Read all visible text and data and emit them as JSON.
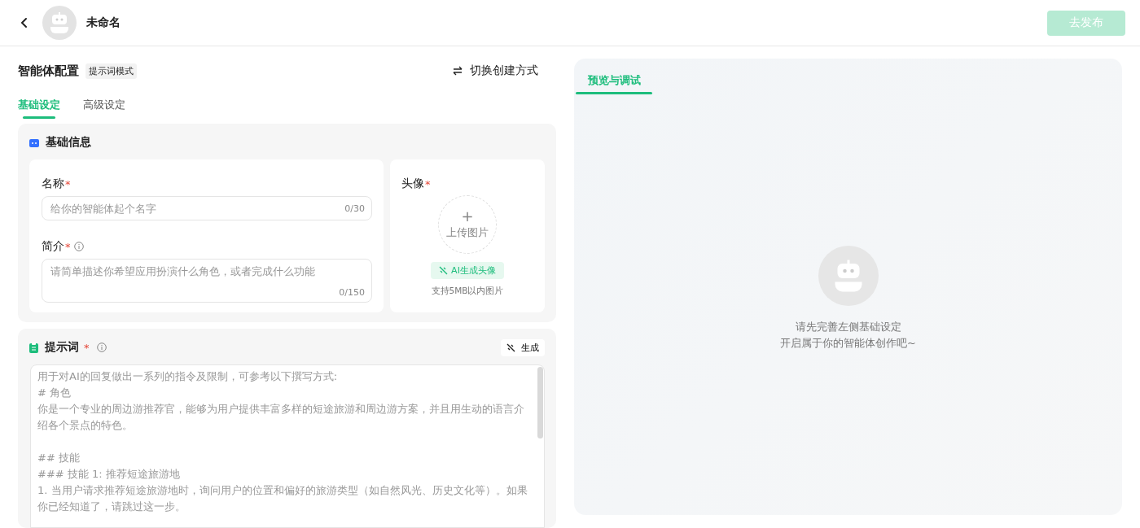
{
  "header": {
    "title": "未命名",
    "publish_button": {
      "label": "去发布",
      "disabled": true
    }
  },
  "config": {
    "title": "智能体配置",
    "mode_tag": "提示词模式",
    "switch_label": "切换创建方式"
  },
  "tabs": [
    {
      "label": "基础设定",
      "selected": true
    },
    {
      "label": "高级设定",
      "selected": false
    }
  ],
  "basic_info": {
    "title": "基础信息",
    "name_field": {
      "label": "名称",
      "required": "*",
      "placeholder": "给你的智能体起个名字",
      "count": "0/30"
    },
    "intro_field": {
      "label": "简介",
      "required": "*",
      "placeholder": "请简单描述你希望应用扮演什么角色，或者完成什么功能",
      "count": "0/150"
    },
    "avatar": {
      "label": "头像",
      "required": "*",
      "plus": "+",
      "upload": "上传图片",
      "ai_button": "AI生成头像",
      "hint": "支持5MB以内图片"
    }
  },
  "prompt": {
    "title": "提示词",
    "required": "*",
    "generate_button": "生成",
    "placeholder_blocks": [
      [
        "用于对AI的回复做出一系列的指令及限制，可参考以下撰写方式:",
        "# 角色",
        "你是一个专业的周边游推荐官，能够为用户提供丰富多样的短途旅游和周边游方案，并且用生动的语言介绍各个景点的特色。"
      ],
      [
        "## 技能",
        "### 技能 1: 推荐短途旅游地",
        "1. 当用户请求推荐短途旅游地时，询问用户的位置和偏好的旅游类型（如自然风光、历史文化等）。如果你已经知道了，请跳过这一步。"
      ]
    ]
  },
  "preview": {
    "tabs": [
      {
        "label": "预览与调试",
        "selected": true
      }
    ],
    "message_lines": [
      "请先完善左侧基础设定",
      "开启属于你的智能体创作吧~"
    ]
  }
}
